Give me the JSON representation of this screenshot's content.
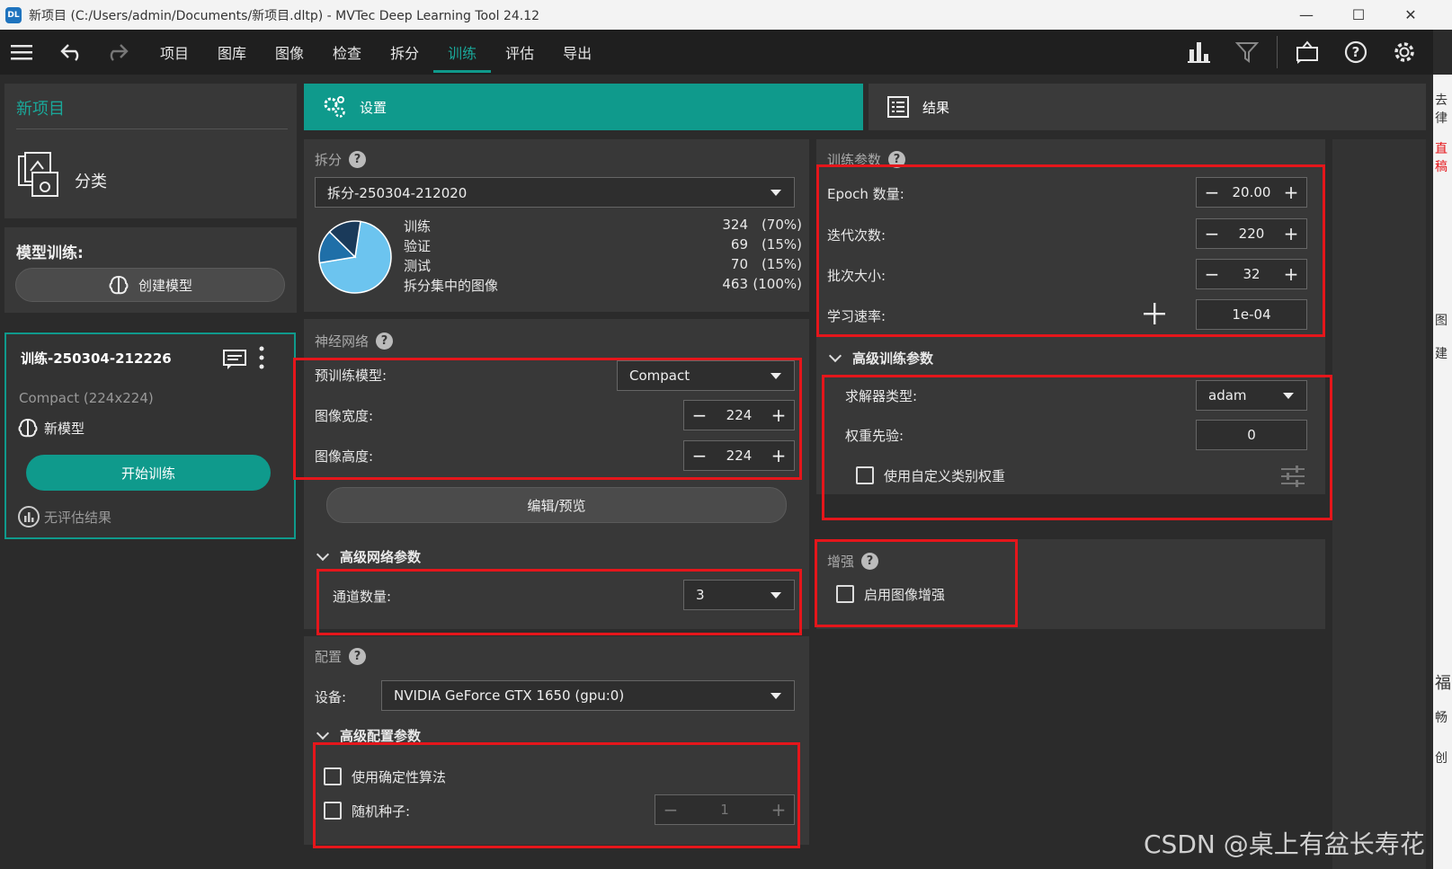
{
  "window": {
    "logo": "DL",
    "title": "新项目 (C:/Users/admin/Documents/新项目.dltp) - MVTec Deep Learning Tool 24.12",
    "minimize": "—",
    "maximize": "☐",
    "close": "✕"
  },
  "menu": {
    "items": [
      "项目",
      "图库",
      "图像",
      "检查",
      "拆分",
      "训练",
      "评估",
      "导出"
    ],
    "active_index": 5
  },
  "left": {
    "project_name": "新项目",
    "classification_label": "分类",
    "training_header": "模型训练:",
    "create_model_label": "创建模型",
    "run_name": "训练-250304-212226",
    "run_model_desc": "Compact (224x224)",
    "new_model_label": "新模型",
    "start_training_label": "开始训练",
    "no_eval_label": "无评估结果"
  },
  "tabs": {
    "settings": "设置",
    "results": "结果"
  },
  "split": {
    "title": "拆分",
    "selected": "拆分-250304-212020",
    "rows": [
      {
        "label": "训练",
        "count": "324",
        "pct": "(70%)"
      },
      {
        "label": "验证",
        "count": "69",
        "pct": "(15%)"
      },
      {
        "label": "测试",
        "count": "70",
        "pct": "(15%)"
      },
      {
        "label": "拆分集中的图像",
        "count": "463",
        "pct": "(100%)"
      }
    ],
    "pie": [
      70,
      15,
      15
    ],
    "pie_colors": [
      "#6cc4ef",
      "#1f6fa8",
      "#1a3a5a"
    ]
  },
  "network": {
    "title": "神经网络",
    "pretrained_label": "预训练模型:",
    "pretrained_value": "Compact",
    "width_label": "图像宽度:",
    "width_value": "224",
    "height_label": "图像高度:",
    "height_value": "224",
    "edit_preview_label": "编辑/预览",
    "advanced_title": "高级网络参数",
    "channels_label": "通道数量:",
    "channels_value": "3"
  },
  "config": {
    "title": "配置",
    "device_label": "设备:",
    "device_value": "NVIDIA GeForce GTX 1650 (gpu:0)",
    "advanced_title": "高级配置参数",
    "deterministic_label": "使用确定性算法",
    "seed_label": "随机种子:",
    "seed_value": "1"
  },
  "training_params": {
    "title": "训练参数",
    "epoch_label": "Epoch 数量:",
    "epoch_value": "20.00",
    "iter_label": "迭代次数:",
    "iter_value": "220",
    "batch_label": "批次大小:",
    "batch_value": "32",
    "lr_label": "学习速率:",
    "lr_value": "1e-04"
  },
  "advanced_training": {
    "title": "高级训练参数",
    "solver_label": "求解器类型:",
    "solver_value": "adam",
    "weight_prior_label": "权重先验:",
    "weight_prior_value": "0",
    "custom_weights_label": "使用自定义类别权重"
  },
  "augmentation": {
    "title": "增强",
    "enable_label": "启用图像增强"
  },
  "watermark": "CSDN @桌上有盆长寿花",
  "right_edge": [
    "去律",
    "直稿",
    "图",
    "建",
    "福",
    "畅",
    "创"
  ]
}
